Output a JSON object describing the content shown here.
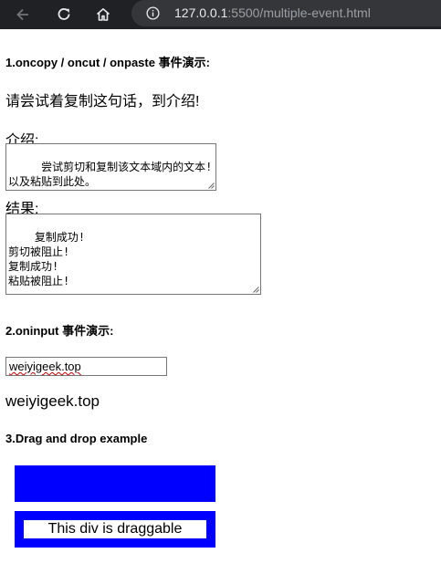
{
  "browser": {
    "url_host": "127.0.0.1",
    "url_rest": ":5500/multiple-event.html"
  },
  "copy_section": {
    "heading": "1.oncopy / oncut / onpaste 事件演示:",
    "paragraph": "请尝试着复制这句话，到介绍!",
    "intro_label": "介绍:",
    "intro_text": " 尝试剪切和复制该文本域内的文本!\n以及粘贴到此处。",
    "result_label": "结果:",
    "result_text": "复制成功!\n剪切被阻止!\n复制成功!\n粘贴被阻止!"
  },
  "input_section": {
    "heading": "2.oninput 事件演示:",
    "input_value": "weiyigeek.top",
    "output_text": "weiyigeek.top"
  },
  "drag_section": {
    "heading": "3.Drag and drop example",
    "drag_text": "This div is draggable"
  },
  "colors": {
    "dropzone": "#0000ff",
    "chrome_bg": "#202124"
  }
}
